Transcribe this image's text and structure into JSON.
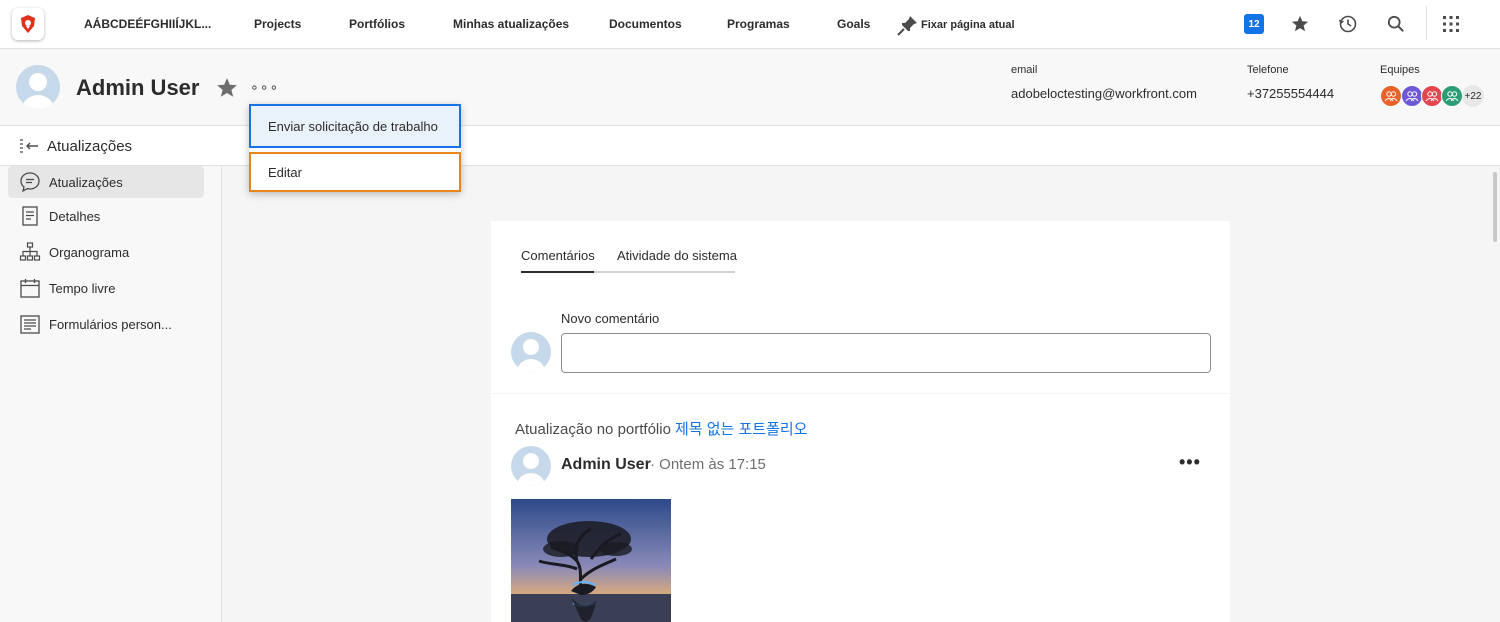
{
  "nav": {
    "org_name": "AÁBCDEÉFGHIIÍJKL...",
    "items": [
      "Projects",
      "Portfólios",
      "Minhas atualizações",
      "Documentos",
      "Programas",
      "Goals"
    ],
    "pin_label": "Fixar página atual",
    "notification_count": "12"
  },
  "header": {
    "user_name": "Admin User",
    "more_label": "∘∘∘",
    "email_label": "email",
    "email_value": "adobeloctesting@workfront.com",
    "phone_label": "Telefone",
    "phone_value": "+37255554444",
    "teams_label": "Equipes",
    "teams_more": "+22",
    "team_colors": [
      "#e34850",
      "#6e58d6",
      "#e34850",
      "#2d9d78"
    ]
  },
  "dropdown": {
    "items": [
      "Enviar solicitação de trabalho",
      "Editar"
    ]
  },
  "subheader": {
    "title": "Atualizações"
  },
  "sidebar": {
    "items": [
      {
        "label": "Atualizações",
        "icon": "comment-icon",
        "active": true
      },
      {
        "label": "Detalhes",
        "icon": "document-icon",
        "active": false
      },
      {
        "label": "Organograma",
        "icon": "org-chart-icon",
        "active": false
      },
      {
        "label": "Tempo livre",
        "icon": "calendar-icon",
        "active": false
      },
      {
        "label": "Formulários person...",
        "icon": "form-icon",
        "active": false
      }
    ]
  },
  "main": {
    "tabs": [
      "Comentários",
      "Atividade do sistema"
    ],
    "new_comment_label": "Novo comentário",
    "update_title": "Atualização no portfólio",
    "update_link": "제목 없는 포트폴리오",
    "post_author": "Admin User",
    "post_time": "Ontem às 17:15",
    "post_more": "•••"
  },
  "colors": {
    "accent": "#1473e6",
    "highlight": "#e68619",
    "logo": "#e0301e"
  }
}
